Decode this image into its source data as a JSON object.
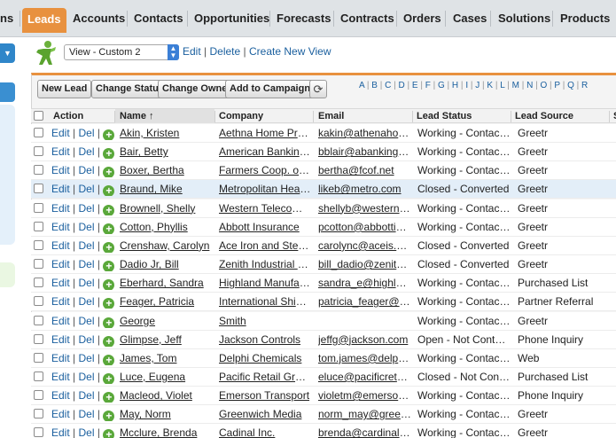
{
  "tabs": [
    {
      "label": "ns",
      "active": false
    },
    {
      "label": "Leads",
      "active": true
    },
    {
      "label": "Accounts",
      "active": false
    },
    {
      "label": "Contacts",
      "active": false
    },
    {
      "label": "Opportunities",
      "active": false
    },
    {
      "label": "Forecasts",
      "active": false
    },
    {
      "label": "Contracts",
      "active": false
    },
    {
      "label": "Orders",
      "active": false
    },
    {
      "label": "Cases",
      "active": false
    },
    {
      "label": "Solutions",
      "active": false
    },
    {
      "label": "Products",
      "active": false
    }
  ],
  "view": {
    "selected": "View - Custom 2",
    "edit": "Edit",
    "delete": "Delete",
    "create": "Create New View"
  },
  "buttons": {
    "new_lead": "New Lead",
    "change_status": "Change Status",
    "change_owner": "Change Owner",
    "add_to_campaign": "Add to Campaign"
  },
  "alphabet": [
    "A",
    "B",
    "C",
    "D",
    "E",
    "F",
    "G",
    "H",
    "I",
    "J",
    "K",
    "L",
    "M",
    "N",
    "O",
    "P",
    "Q",
    "R"
  ],
  "columns": {
    "action": "Action",
    "name": "Name",
    "sort_indicator": "↑",
    "company": "Company",
    "email": "Email",
    "lead_status": "Lead Status",
    "lead_source": "Lead Source",
    "next": "S"
  },
  "row_actions": {
    "edit": "Edit",
    "del": "Del"
  },
  "rows": [
    {
      "name": "Akin, Kristen",
      "company": "Aethna Home Prod...",
      "email": "kakin@athenahome....",
      "status": "Working - Contacted",
      "source": "Greetr"
    },
    {
      "name": "Bair, Betty",
      "company": "American Banking ...",
      "email": "bblair@abankingco....",
      "status": "Working - Contacted",
      "source": "Greetr"
    },
    {
      "name": "Boxer, Bertha",
      "company": "Farmers Coop. of Fl...",
      "email": "bertha@fcof.net",
      "status": "Working - Contacted",
      "source": "Greetr"
    },
    {
      "name": "Braund, Mike",
      "company": "Metropolitan Health...",
      "email": "likeb@metro.com",
      "status": "Closed - Converted",
      "source": "Greetr",
      "highlight": true
    },
    {
      "name": "Brownell, Shelly",
      "company": "Western Telecomm...",
      "email": "shellyb@westerntel...",
      "status": "Working - Contacted",
      "source": "Greetr"
    },
    {
      "name": "Cotton, Phyllis",
      "company": "Abbott Insurance",
      "email": "pcotton@abbottins....",
      "status": "Working - Contacted",
      "source": "Greetr"
    },
    {
      "name": "Crenshaw, Carolyn",
      "company": "Ace Iron and Steel I...",
      "email": "carolync@aceis.com",
      "status": "Closed - Converted",
      "source": "Greetr"
    },
    {
      "name": "Dadio Jr, Bill",
      "company": "Zenith Industrial Pa...",
      "email": "bill_dadio@zenith.c...",
      "status": "Closed - Converted",
      "source": "Greetr"
    },
    {
      "name": "Eberhard, Sandra",
      "company": "Highland Manufactu...",
      "email": "sandra_e@highlan...",
      "status": "Working - Contacted",
      "source": "Purchased List"
    },
    {
      "name": "Feager, Patricia",
      "company": "International Shippi...",
      "email": "patricia_feager@is....",
      "status": "Working - Contacted",
      "source": "Partner Referral"
    },
    {
      "name": "George",
      "company": "Smith",
      "email": "",
      "status": "Working - Contacted",
      "source": "Greetr"
    },
    {
      "name": "Glimpse, Jeff",
      "company": "Jackson Controls",
      "email": "jeffg@jackson.com",
      "status": "Open - Not Contacted",
      "source": "Phone Inquiry"
    },
    {
      "name": "James, Tom",
      "company": "Delphi Chemicals",
      "email": "tom.james@delphi....",
      "status": "Working - Contacted",
      "source": "Web"
    },
    {
      "name": "Luce, Eugena",
      "company": "Pacific Retail Group",
      "email": "eluce@pacificretail....",
      "status": "Closed - Not Conve...",
      "source": "Purchased List"
    },
    {
      "name": "Macleod, Violet",
      "company": "Emerson Transport",
      "email": "violetm@emersontr....",
      "status": "Working - Contacted",
      "source": "Phone Inquiry"
    },
    {
      "name": "May, Norm",
      "company": "Greenwich Media",
      "email": "norm_may@green....",
      "status": "Working - Contacted",
      "source": "Greetr"
    },
    {
      "name": "Mcclure, Brenda",
      "company": "Cadinal Inc.",
      "email": "brenda@cardinal.net",
      "status": "Working - Contacted",
      "source": "Greetr"
    }
  ]
}
